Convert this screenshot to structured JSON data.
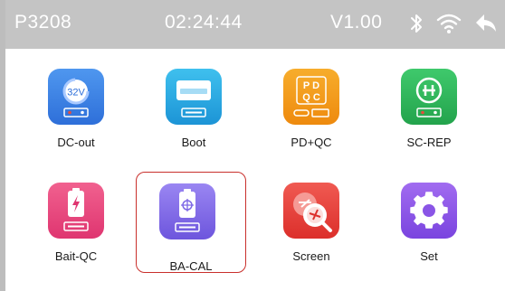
{
  "status": {
    "model": "P3208",
    "time": "02:24:44",
    "version": "V1.00",
    "icons": [
      "bluetooth-icon",
      "wifi-icon",
      "back-icon"
    ]
  },
  "apps": [
    {
      "label": "DC-out",
      "icon": "dc-out-icon",
      "badge": "32V",
      "color": "#3a86e8"
    },
    {
      "label": "Boot",
      "icon": "boot-icon",
      "color": "#25a6e0"
    },
    {
      "label": "PD+QC",
      "icon": "pd-qc-icon",
      "badge": "PD QC",
      "color": "#f29a18"
    },
    {
      "label": "SC-REP",
      "icon": "sc-rep-icon",
      "color": "#2fb35a"
    },
    {
      "label": "Bait-QC",
      "icon": "bait-qc-icon",
      "color": "#e8477c"
    },
    {
      "label": "BA-CAL",
      "icon": "ba-cal-icon",
      "color": "#7d67e6",
      "selected": true
    },
    {
      "label": "Screen",
      "icon": "screen-icon",
      "color": "#e8413b"
    },
    {
      "label": "Set",
      "icon": "settings-icon",
      "color": "#8a55e6"
    }
  ],
  "colors": {
    "status_bar": "#c4c4c4",
    "selection_border": "#c9302c"
  }
}
